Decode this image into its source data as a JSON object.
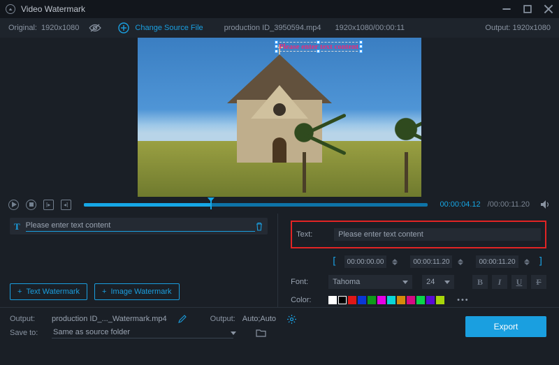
{
  "app": {
    "title": "Video Watermark"
  },
  "source": {
    "original_label": "Original:",
    "original_res": "1920x1080",
    "change_label": "Change Source File",
    "filename": "production ID_3950594.mp4",
    "meta": "1920x1080/00:00:11",
    "output_label": "Output:",
    "output_res": "1920x1080"
  },
  "overlay": {
    "placeholder": "Please enter text content"
  },
  "transport": {
    "current": "00:00:04.12",
    "duration": "00:00:11.20"
  },
  "layer": {
    "text": "Please enter text content"
  },
  "buttons": {
    "text_wm": "Text Watermark",
    "image_wm": "Image Watermark",
    "export": "Export"
  },
  "props": {
    "text_label": "Text:",
    "text_value": "Please enter text content",
    "range_start": "00:00:00.00",
    "range_end": "00:00:11.20",
    "range_dur": "00:00:11.20",
    "font_label": "Font:",
    "font_name": "Tahoma",
    "font_size": "24",
    "color_label": "Color:"
  },
  "colors": [
    "#ffffff",
    "#000000",
    "#e01717",
    "#0a37d6",
    "#0f9b1a",
    "#e600e6",
    "#0ad6d6",
    "#d68a0a",
    "#d60a84",
    "#0ad64a",
    "#5a0ad6",
    "#a8d60a"
  ],
  "output": {
    "label": "Output:",
    "filename": "production ID_..._Watermark.mp4",
    "label2": "Output:",
    "preset": "Auto;Auto",
    "save_label": "Save to:",
    "save_path": "Same as source folder"
  }
}
